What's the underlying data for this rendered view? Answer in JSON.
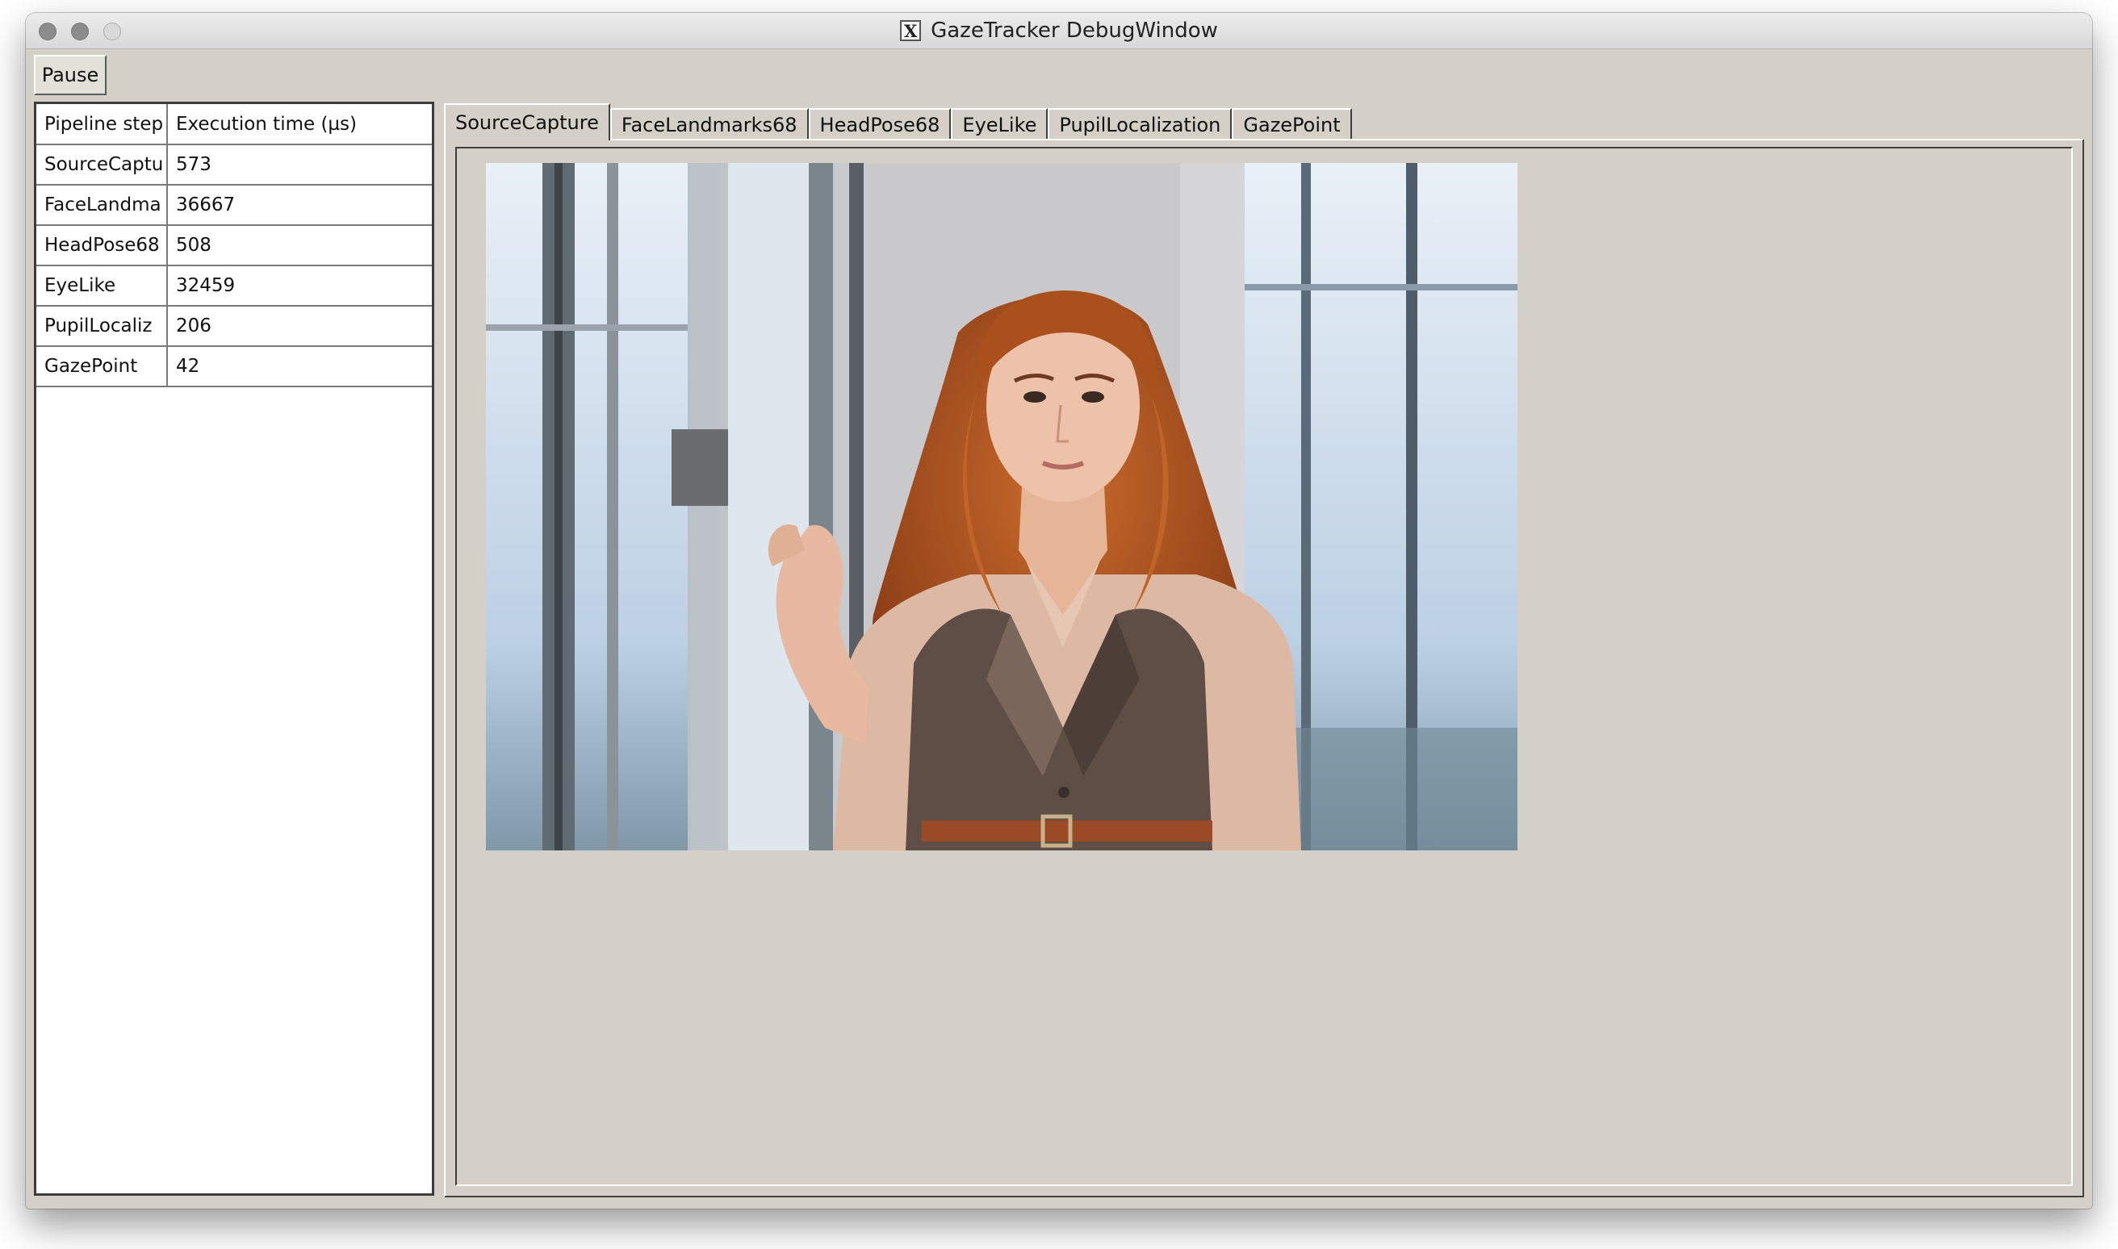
{
  "window": {
    "title": "GazeTracker DebugWindow",
    "app_icon": "X",
    "titlebar_buttons": [
      "close",
      "minimize",
      "zoom"
    ]
  },
  "toolbar": {
    "pause_label": "Pause"
  },
  "pipeline_table": {
    "headers": [
      "Pipeline step",
      "Execution time (µs)"
    ],
    "rows": [
      {
        "step": "SourceCaptu",
        "time": "573"
      },
      {
        "step": "FaceLandma",
        "time": "36667"
      },
      {
        "step": "HeadPose68",
        "time": "508"
      },
      {
        "step": "EyeLike",
        "time": "32459"
      },
      {
        "step": "PupilLocaliz",
        "time": "206"
      },
      {
        "step": "GazePoint",
        "time": "42"
      }
    ]
  },
  "tabs": [
    {
      "label": "SourceCapture",
      "active": true
    },
    {
      "label": "FaceLandmarks68",
      "active": false
    },
    {
      "label": "HeadPose68",
      "active": false
    },
    {
      "label": "EyeLike",
      "active": false
    },
    {
      "label": "PupilLocalization",
      "active": false
    },
    {
      "label": "GazePoint",
      "active": false
    }
  ],
  "capture_image": {
    "subject": "woman with long auburn wavy hair, beige blouse, grey-brown vest and brown belt, standing near bright windows"
  },
  "colors": {
    "window_bg": "#d4d0c8",
    "hair": "#b5561f",
    "vest": "#5e4e45",
    "blouse": "#ddb8a2",
    "belt": "#9a4a24"
  }
}
